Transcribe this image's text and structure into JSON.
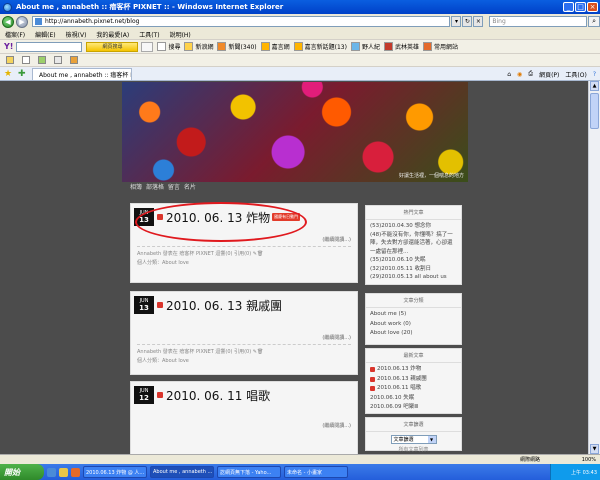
{
  "window": {
    "title": "About me , annabeth :: 瘖客杯 PIXNET :: - Windows Internet Explorer"
  },
  "address": {
    "url": "http://annabeth.pixnet.net/blog",
    "search_placeholder": "Bing"
  },
  "menu": [
    "檔案(F)",
    "編輯(E)",
    "檢視(V)",
    "我的最愛(A)",
    "工具(T)",
    "說明(H)"
  ],
  "toolbar_a": {
    "search_label": "搜尋",
    "web_search_button": "網頁搜尋",
    "items": [
      "新浪網",
      "新聞(340)",
      "嘉言網",
      "嘉言新話題(13)",
      "野人紀",
      "武林英雄",
      "常用網站"
    ]
  },
  "tab": {
    "label": "About me , annabeth :: 瘖客杯 PIXNET ::"
  },
  "tab_tools": [
    "網頁(P)",
    "工具(O)"
  ],
  "blog": {
    "banner_caption": "好讓生活裡，一個喘息的地方",
    "nav": [
      "相簿",
      "部落格",
      "留言",
      "名片"
    ],
    "posts": [
      {
        "month": "JUN",
        "day": "13",
        "title": "2010. 06. 13  炸物",
        "badge": "國慶有日動門",
        "read_more": "(繼續閱讀...)",
        "meta": "Annabeth 發表在 瘖客杯 PIXNET 迴響(0) 引用(0)",
        "category": "個人分類：About love"
      },
      {
        "month": "JUN",
        "day": "13",
        "title": "2010. 06. 13  親戚團",
        "read_more": "(繼續閱讀...)",
        "meta": "Annabeth 發表在 瘖客杯 PIXNET 迴響(0) 引用(0)",
        "category": "個人分類：About love"
      },
      {
        "month": "JUN",
        "day": "12",
        "title": "2010. 06. 11  唱歌",
        "read_more": "(繼續閱讀...)"
      }
    ],
    "sidebar": {
      "hot": {
        "title": "熱門文章",
        "items": [
          "(53)2010.04.30 想念你",
          "(48)不能沒有你，你懂嗎？搞了一陣，失去對方卻還能活著，心卻還一處留在那裡…",
          "(35)2010.06.10 失眠",
          "(32)2010.05.11 收割日",
          "(29)2010.05.13 all about us"
        ]
      },
      "categories": {
        "title": "文章分類",
        "items": [
          "About me (5)",
          "About work (0)",
          "About love (20)"
        ]
      },
      "latest": {
        "title": "最新文章",
        "items": [
          "2010.06.13 炸物",
          "2010.06.13 親戚團",
          "2010.06.11 唱歌",
          "2010.06.10 失眠",
          "2010.06.09 吧聚Ⅲ"
        ]
      },
      "search": {
        "title": "文章篩選",
        "select_value": "文章篩選",
        "all_link": "所有文章列表"
      }
    }
  },
  "status": {
    "zone": "網際網路",
    "zoom": "100%"
  },
  "taskbar": {
    "start": "開始",
    "tasks": [
      "2010.06.13 炸物 @ 人...",
      "About me , annabeth ...",
      "訖網頁無下落 - Yaho...",
      "未命名 - 小畫家"
    ],
    "clock": "上午 03:43"
  }
}
